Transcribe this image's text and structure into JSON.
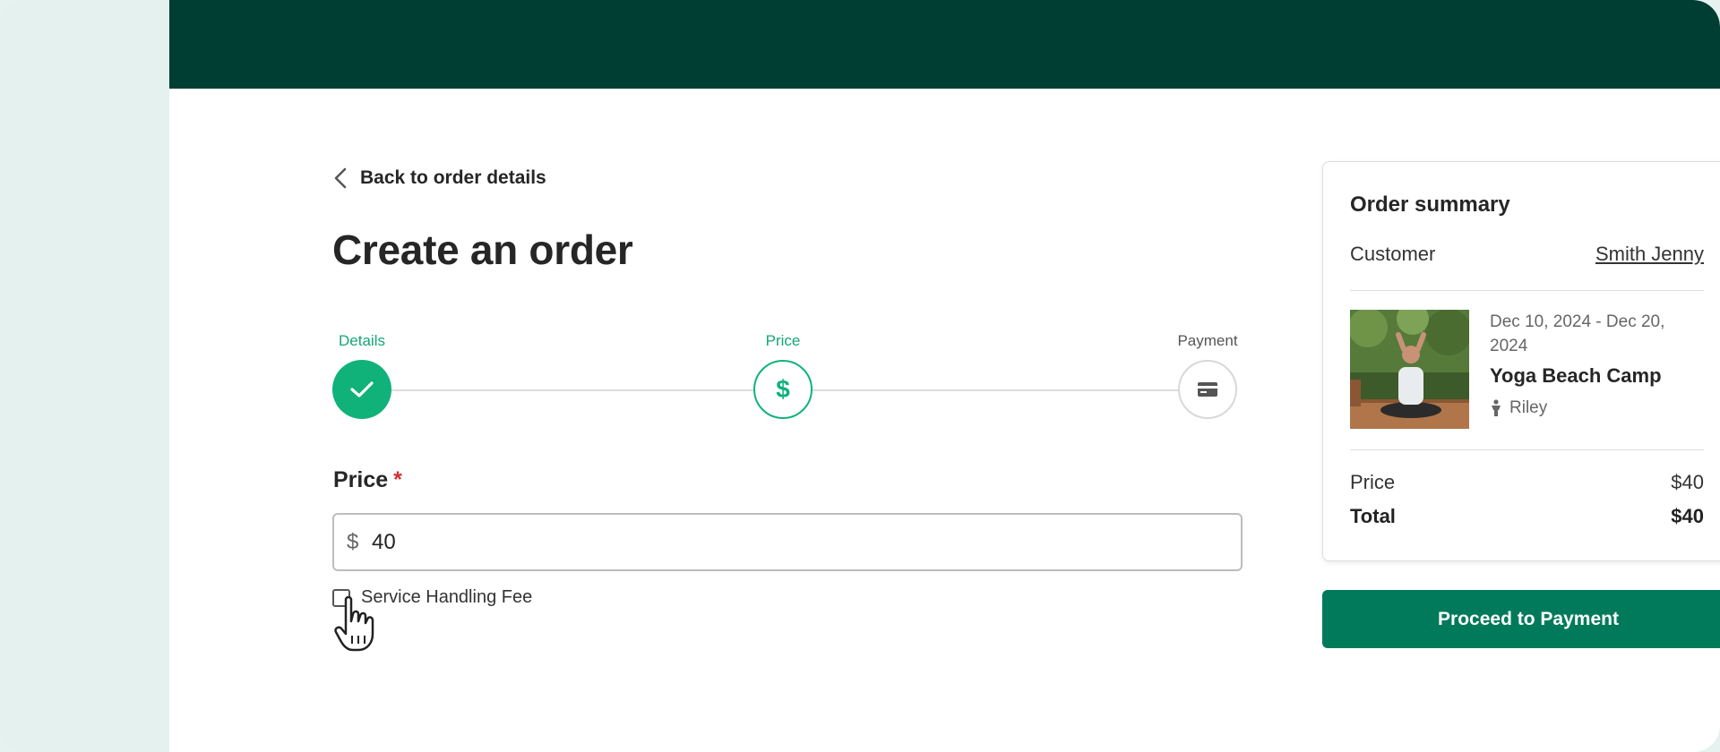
{
  "nav": {
    "back_label": "Back to order details"
  },
  "page": {
    "title": "Create an order"
  },
  "stepper": {
    "steps": [
      {
        "label": "Details",
        "state": "complete"
      },
      {
        "label": "Price",
        "state": "active"
      },
      {
        "label": "Payment",
        "state": "pending"
      }
    ],
    "price_glyph": "$"
  },
  "form": {
    "price_label": "Price",
    "required_mark": "*",
    "currency_symbol": "$",
    "price_value": "40",
    "fee_label": "Service Handling Fee",
    "fee_checked": false
  },
  "summary": {
    "title": "Order summary",
    "customer_label": "Customer",
    "customer_name": "Smith Jenny",
    "event": {
      "dates": "Dec 10, 2024 - Dec 20, 2024",
      "name": "Yoga Beach Camp",
      "attendee": "Riley"
    },
    "price_label": "Price",
    "price_value": "$40",
    "total_label": "Total",
    "total_value": "$40"
  },
  "actions": {
    "proceed_label": "Proceed to Payment"
  },
  "colors": {
    "header": "#003d33",
    "accent": "#10b27a",
    "primary_button": "#007a5a",
    "sidebar": "#e4f1ee",
    "required": "#d32f2f"
  }
}
